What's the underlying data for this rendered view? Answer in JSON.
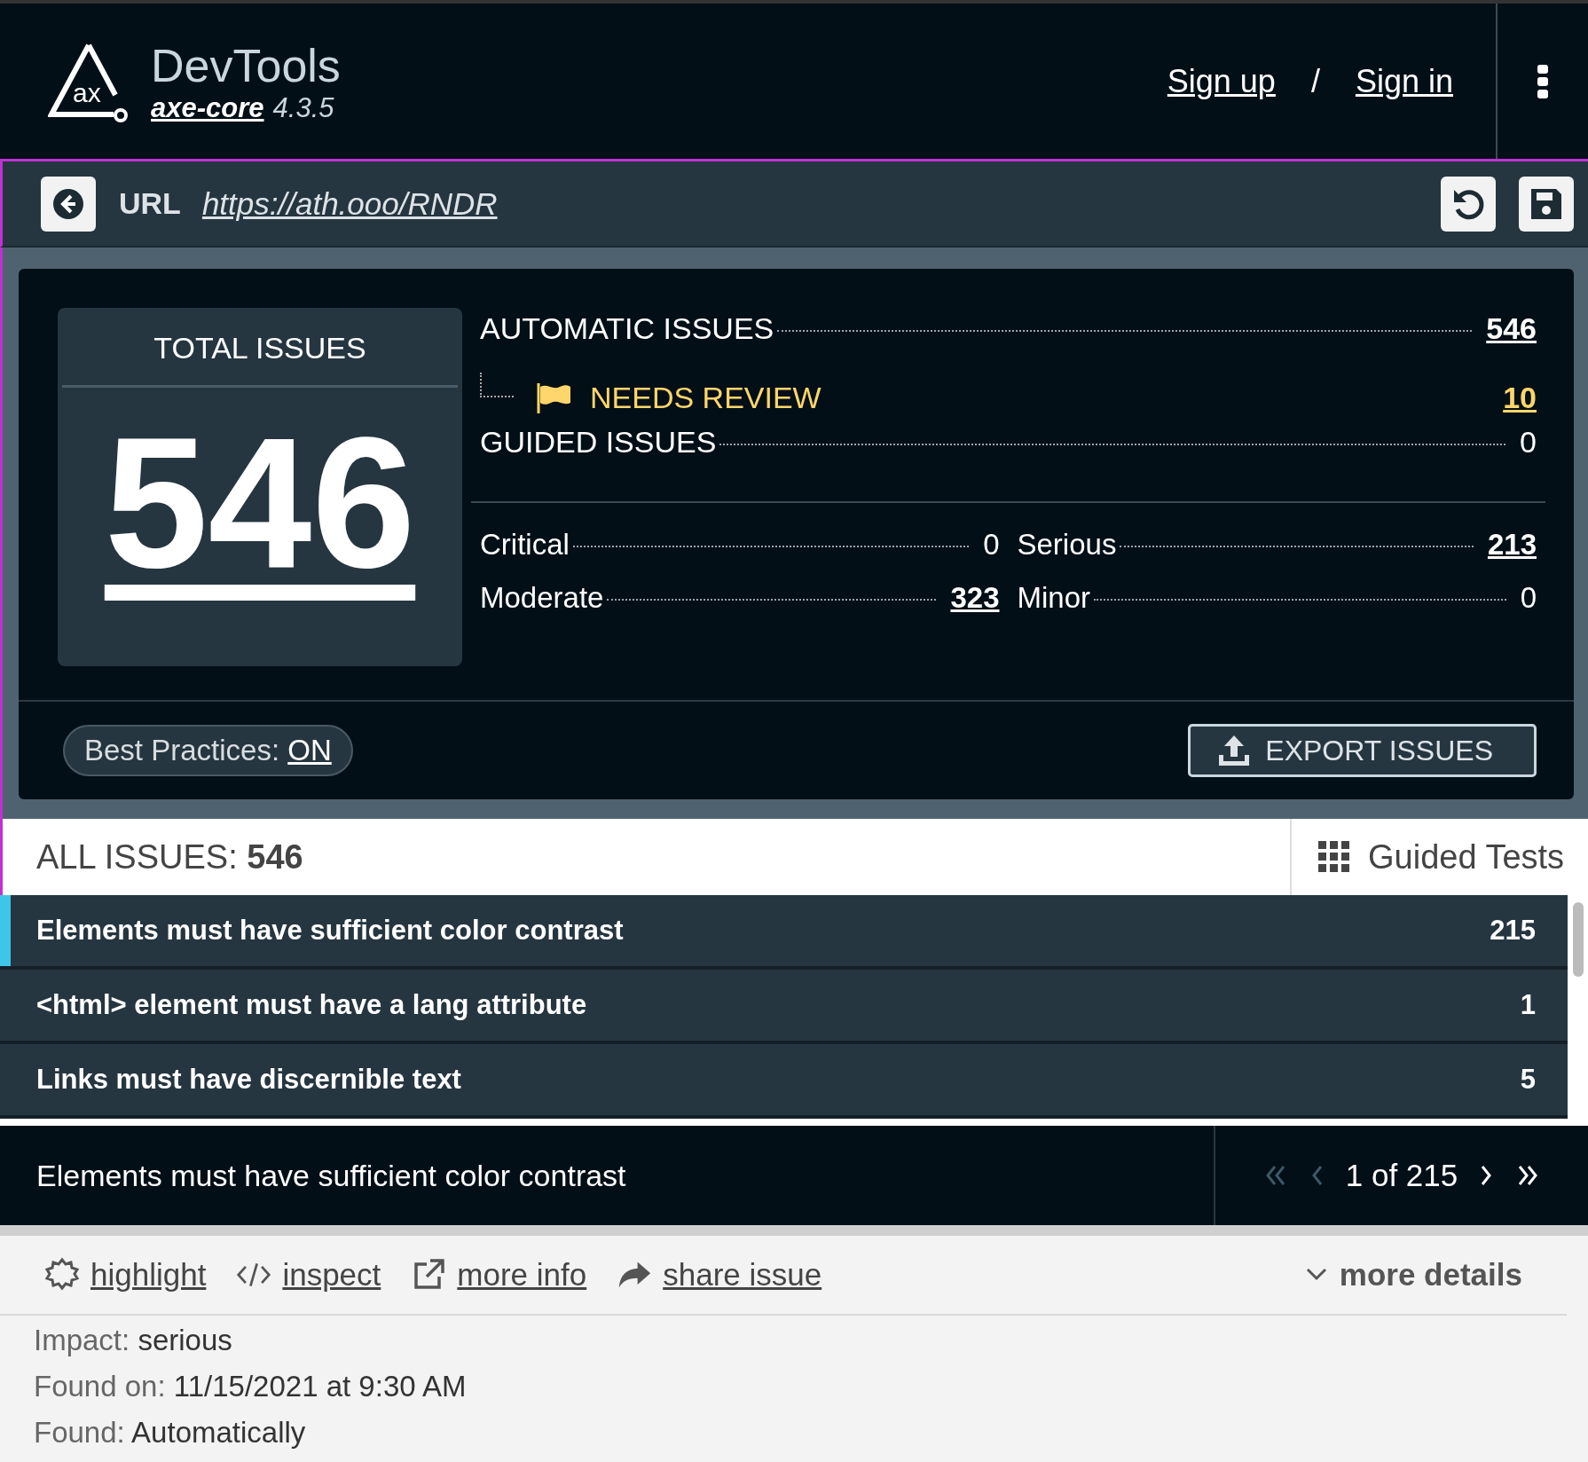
{
  "header": {
    "logo_text": "ax",
    "title": "DevTools",
    "product": "axe-core",
    "version": "4.3.5",
    "links": [
      {
        "label": "Sign up"
      },
      {
        "label": "Sign in"
      }
    ],
    "separator": "/"
  },
  "url_bar": {
    "label": "URL",
    "value": "https://ath.ooo/RNDR"
  },
  "summary": {
    "total_label": "TOTAL ISSUES",
    "total": "546",
    "automatic": {
      "label": "AUTOMATIC ISSUES",
      "value": "546",
      "linked": true
    },
    "needs_review": {
      "label": "NEEDS REVIEW",
      "value": "10",
      "linked": true
    },
    "guided": {
      "label": "GUIDED ISSUES",
      "value": "0",
      "linked": false
    },
    "impacts": [
      {
        "label": "Critical",
        "value": "0",
        "linked": false
      },
      {
        "label": "Serious",
        "value": "213",
        "linked": true
      },
      {
        "label": "Moderate",
        "value": "323",
        "linked": true
      },
      {
        "label": "Minor",
        "value": "0",
        "linked": false
      }
    ],
    "best_practices": {
      "label": "Best Practices:",
      "value": "ON"
    },
    "export_label": "EXPORT ISSUES"
  },
  "issues_header": {
    "label": "ALL ISSUES:",
    "count": "546",
    "guided_tests": "Guided Tests"
  },
  "issues": [
    {
      "title": "Elements must have sufficient color contrast",
      "count": "215",
      "selected": true
    },
    {
      "title": "<html> element must have a lang attribute",
      "count": "1",
      "selected": false
    },
    {
      "title": "Links must have discernible text",
      "count": "5",
      "selected": false
    }
  ],
  "current": {
    "title": "Elements must have sufficient color contrast",
    "position": "1 of 215",
    "first_disabled": true,
    "prev_disabled": true,
    "next_disabled": false,
    "last_disabled": false
  },
  "actions": [
    {
      "kind": "highlight",
      "label": "highlight"
    },
    {
      "kind": "inspect",
      "label": "inspect"
    },
    {
      "kind": "more_info",
      "label": "more info"
    },
    {
      "kind": "share",
      "label": "share issue"
    }
  ],
  "more_details": {
    "label": "more details",
    "expanded": false
  },
  "details": [
    {
      "label": "Impact:",
      "value": "serious"
    },
    {
      "label": "Found on:",
      "value": "11/15/2021 at 9:30 AM"
    },
    {
      "label": "Found:",
      "value": "Automatically"
    }
  ]
}
